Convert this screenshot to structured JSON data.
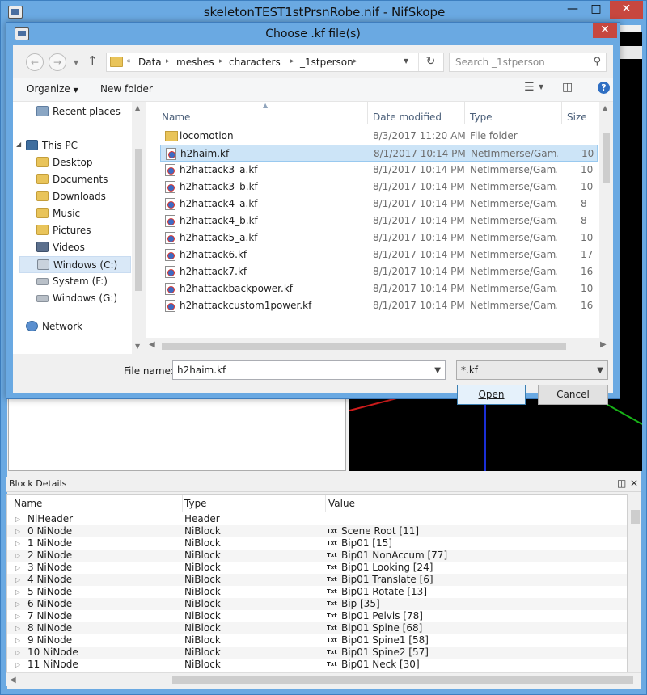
{
  "main_window": {
    "title": "skeletonTEST1stPrsnRobe.nif - NifSkope",
    "minimize_glyph": "—",
    "maximize_glyph": "□",
    "close_glyph": "✕"
  },
  "dialog": {
    "title": "Choose .kf file(s)",
    "close_glyph": "✕",
    "breadcrumb": [
      "Data",
      "meshes",
      "characters",
      "_1stperson"
    ],
    "breadcrumb_overflow": "«",
    "search_placeholder": "Search _1stperson",
    "toolbar": {
      "organize": "Organize",
      "new_folder": "New folder"
    },
    "nav_pane": {
      "items": [
        {
          "label": "Recent places",
          "icon": "recent-places-icon"
        },
        {
          "label": "This PC",
          "icon": "computer-icon"
        },
        {
          "label": "Desktop",
          "icon": "desktop-folder-icon"
        },
        {
          "label": "Documents",
          "icon": "documents-folder-icon"
        },
        {
          "label": "Downloads",
          "icon": "downloads-folder-icon"
        },
        {
          "label": "Music",
          "icon": "music-folder-icon"
        },
        {
          "label": "Pictures",
          "icon": "pictures-folder-icon"
        },
        {
          "label": "Videos",
          "icon": "videos-folder-icon"
        },
        {
          "label": "Windows (C:)",
          "icon": "windows-drive-icon",
          "selected": true
        },
        {
          "label": "System (F:)",
          "icon": "drive-icon"
        },
        {
          "label": "Windows (G:)",
          "icon": "drive-icon"
        },
        {
          "label": "Network",
          "icon": "network-icon"
        }
      ]
    },
    "columns": {
      "name": "Name",
      "date": "Date modified",
      "type": "Type",
      "size": "Size"
    },
    "files": [
      {
        "name": "locomotion",
        "date": "8/3/2017 11:20 AM",
        "type": "File folder",
        "size": "",
        "folder": true
      },
      {
        "name": "h2haim.kf",
        "date": "8/1/2017 10:14 PM",
        "type": "NetImmerse/Gam...",
        "size": "10",
        "selected": true
      },
      {
        "name": "h2hattack3_a.kf",
        "date": "8/1/2017 10:14 PM",
        "type": "NetImmerse/Gam...",
        "size": "10"
      },
      {
        "name": "h2hattack3_b.kf",
        "date": "8/1/2017 10:14 PM",
        "type": "NetImmerse/Gam...",
        "size": "10"
      },
      {
        "name": "h2hattack4_a.kf",
        "date": "8/1/2017 10:14 PM",
        "type": "NetImmerse/Gam...",
        "size": "8"
      },
      {
        "name": "h2hattack4_b.kf",
        "date": "8/1/2017 10:14 PM",
        "type": "NetImmerse/Gam...",
        "size": "8"
      },
      {
        "name": "h2hattack5_a.kf",
        "date": "8/1/2017 10:14 PM",
        "type": "NetImmerse/Gam...",
        "size": "10"
      },
      {
        "name": "h2hattack6.kf",
        "date": "8/1/2017 10:14 PM",
        "type": "NetImmerse/Gam...",
        "size": "17"
      },
      {
        "name": "h2hattack7.kf",
        "date": "8/1/2017 10:14 PM",
        "type": "NetImmerse/Gam...",
        "size": "16"
      },
      {
        "name": "h2hattackbackpower.kf",
        "date": "8/1/2017 10:14 PM",
        "type": "NetImmerse/Gam...",
        "size": "10"
      },
      {
        "name": "h2hattackcustom1power.kf",
        "date": "8/1/2017 10:14 PM",
        "type": "NetImmerse/Gam...",
        "size": "16"
      }
    ],
    "file_name_label": "File name:",
    "file_name_value": "h2haim.kf",
    "file_type_value": "*.kf",
    "open_label": "Open",
    "cancel_label": "Cancel"
  },
  "block_details": {
    "title": "Block Details",
    "columns": {
      "name": "Name",
      "type": "Type",
      "value": "Value"
    },
    "txt_tag": "Txt",
    "rows": [
      {
        "name": "NiHeader",
        "type": "Header",
        "value": ""
      },
      {
        "name": "0 NiNode",
        "type": "NiBlock",
        "value": "Scene Root [11]"
      },
      {
        "name": "1 NiNode",
        "type": "NiBlock",
        "value": "Bip01 [15]"
      },
      {
        "name": "2 NiNode",
        "type": "NiBlock",
        "value": "Bip01 NonAccum [77]"
      },
      {
        "name": "3 NiNode",
        "type": "NiBlock",
        "value": "Bip01 Looking [24]"
      },
      {
        "name": "4 NiNode",
        "type": "NiBlock",
        "value": "Bip01 Translate [6]"
      },
      {
        "name": "5 NiNode",
        "type": "NiBlock",
        "value": "Bip01 Rotate [13]"
      },
      {
        "name": "6 NiNode",
        "type": "NiBlock",
        "value": "Bip [35]"
      },
      {
        "name": "7 NiNode",
        "type": "NiBlock",
        "value": "Bip01 Pelvis [78]"
      },
      {
        "name": "8 NiNode",
        "type": "NiBlock",
        "value": "Bip01 Spine [68]"
      },
      {
        "name": "9 NiNode",
        "type": "NiBlock",
        "value": "Bip01 Spine1 [58]"
      },
      {
        "name": "10 NiNode",
        "type": "NiBlock",
        "value": "Bip01 Spine2 [57]"
      },
      {
        "name": "11 NiNode",
        "type": "NiBlock",
        "value": "Bip01 Neck [30]"
      }
    ]
  },
  "colors": {
    "window_frame": "#6aa9e2",
    "close_red": "#c7473f",
    "selection": "#cce4f7",
    "folder_yellow": "#e9c45a"
  }
}
